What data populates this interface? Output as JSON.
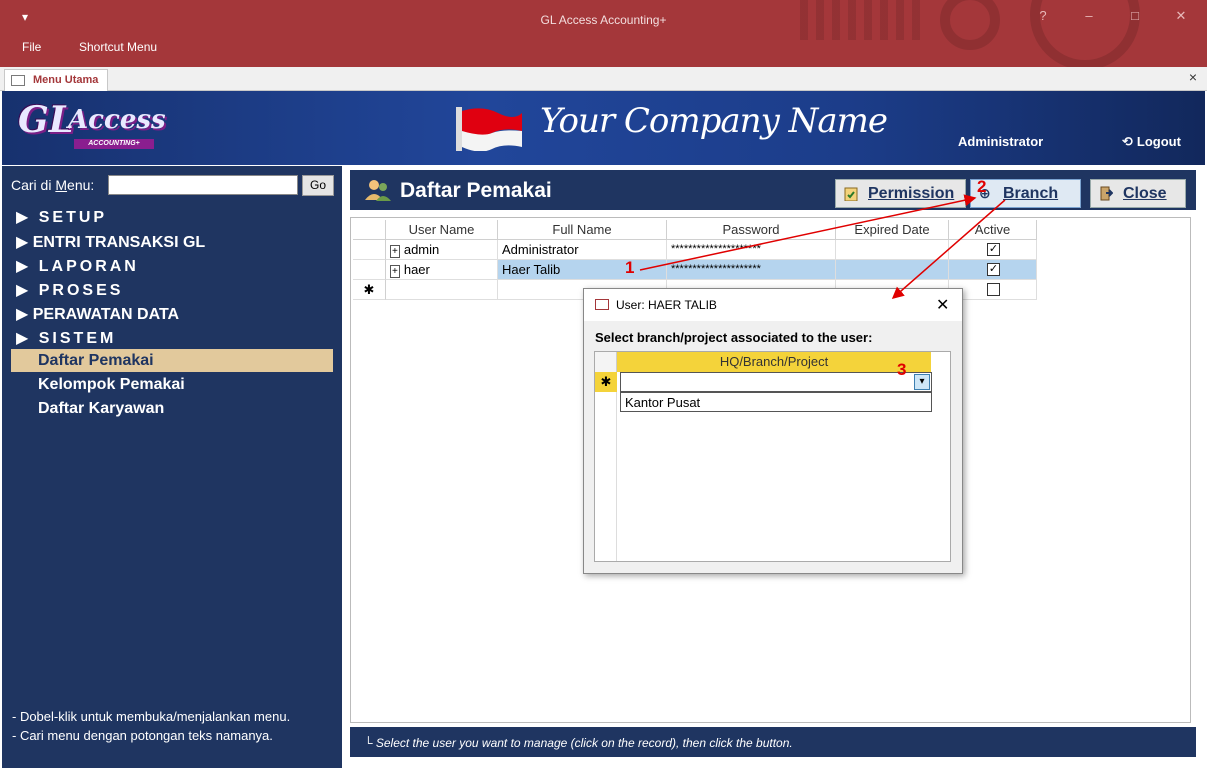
{
  "window": {
    "title": "GL Access Accounting+",
    "qat_icon": "dropdown-arrow",
    "menu": [
      "File",
      "Shortcut Menu"
    ],
    "controls": [
      "?",
      "–",
      "□",
      "✕"
    ]
  },
  "tab": {
    "label": "Menu Utama",
    "close": "×"
  },
  "banner": {
    "logo_main": "GL",
    "logo_text": "Access",
    "logo_sub": "ACCOUNTING+",
    "company": "Your Company Name",
    "user": "Administrator",
    "logout": "Logout"
  },
  "sidebar": {
    "search_label_prefix": "Cari di ",
    "search_label_u": "M",
    "search_label_rest": "enu:",
    "search_value": "",
    "go_label": "Go",
    "menu": [
      "SETUP",
      "ENTRI TRANSAKSI GL",
      "LAPORAN",
      "PROSES",
      "PERAWATAN DATA",
      "SISTEM"
    ],
    "submenu": [
      "Daftar Pemakai",
      "Kelompok Pemakai",
      "Daftar Karyawan"
    ],
    "hints": [
      "- Dobel-klik untuk membuka/menjalankan menu.",
      "- Cari menu dengan potongan teks namanya."
    ]
  },
  "form": {
    "title": "Daftar Pemakai",
    "buttons": {
      "permission": "Permission",
      "branch": "Branch",
      "close": "Close"
    },
    "columns": [
      "User Name",
      "Full Name",
      "Password",
      "Expired Date",
      "Active"
    ],
    "rows": [
      {
        "user": "admin",
        "full": "Administrator",
        "pass": "*********************",
        "expired": "",
        "active": true
      },
      {
        "user": "haer",
        "full": "Haer Talib",
        "pass": "*********************",
        "expired": "",
        "active": true
      }
    ],
    "new_row_marker": "✱",
    "footer": "Select the user you want to manage (click on the record), then click the button."
  },
  "dialog": {
    "title": "User: HAER TALIB",
    "close": "✕",
    "label": "Select branch/project associated to the user:",
    "column": "HQ/Branch/Project",
    "value": "",
    "option": "Kantor Pusat",
    "new_row_marker": "✱"
  },
  "annotations": {
    "a1": "1",
    "a2": "2",
    "a3": "3"
  },
  "colors": {
    "titlebar": "#a4373a",
    "navy": "#1f3561",
    "selection": "#e2c99c",
    "highlight": "#b5d4ee",
    "annotation": "#e00000"
  }
}
